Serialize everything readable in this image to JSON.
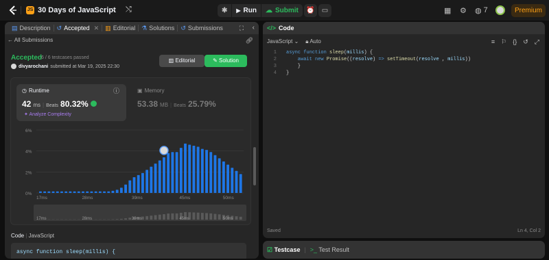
{
  "topbar": {
    "title": "30 Days of JavaScript",
    "run_label": "Run",
    "submit_label": "Submit",
    "streak_count": "7",
    "premium_label": "Premium",
    "js_badge": "JS"
  },
  "left_tabs": [
    {
      "label": "Description",
      "icon": "document-icon"
    },
    {
      "label": "Accepted",
      "icon": "history-icon"
    },
    {
      "label": "Editorial",
      "icon": "book-icon"
    },
    {
      "label": "Solutions",
      "icon": "flask-icon"
    },
    {
      "label": "Submissions",
      "icon": "history-icon"
    }
  ],
  "submission": {
    "back_label": "All Submissions",
    "status": "Accepted",
    "passed": "6 / 6 testcases passed",
    "user": "divyarochani",
    "submitted": "submitted at Mar 19, 2025 22:30",
    "editorial_btn": "Editorial",
    "solution_btn": "Solution"
  },
  "runtime": {
    "label": "Runtime",
    "value": "42",
    "unit": "ms",
    "beats_label": "Beats",
    "beats_value": "80.32%",
    "analyze": "Analyze Complexity"
  },
  "memory": {
    "label": "Memory",
    "value": "53.38",
    "unit": "MB",
    "beats_label": "Beats",
    "beats_value": "25.79%"
  },
  "chart_data": {
    "type": "bar",
    "y_ticks": [
      "6%",
      "4%",
      "2%",
      "0%"
    ],
    "ylim": [
      0,
      6
    ],
    "x_ticks": [
      "17ms",
      "28ms",
      "39ms",
      "45ms",
      "50ms"
    ],
    "mini_ticks": [
      "17ms",
      "28ms",
      "39ms",
      "45ms",
      "50ms"
    ],
    "values": [
      0.15,
      0.15,
      0.15,
      0.15,
      0.15,
      0.15,
      0.15,
      0.15,
      0.15,
      0.15,
      0.15,
      0.15,
      0.15,
      0.15,
      0.15,
      0.15,
      0.15,
      0.2,
      0.3,
      0.5,
      0.8,
      1.2,
      1.5,
      1.7,
      1.9,
      2.2,
      2.5,
      2.8,
      3.1,
      3.4,
      3.8,
      3.9,
      3.9,
      4.3,
      4.7,
      4.6,
      4.5,
      4.4,
      4.2,
      4.1,
      3.9,
      3.6,
      3.3,
      3.0,
      2.7,
      2.4,
      2.1,
      1.8
    ],
    "highlight_index": 29
  },
  "code_section": {
    "label": "Code",
    "lang": "JavaScript",
    "preview": "async function sleep(millis) {"
  },
  "editor": {
    "title": "Code",
    "language": "JavaScript",
    "auto": "Auto",
    "lines": [
      {
        "n": "1",
        "text": "async function sleep(millis) {"
      },
      {
        "n": "2",
        "text": "    await new Promise((resolve) => setTimeout(resolve , millis))"
      },
      {
        "n": "3",
        "text": "    }"
      },
      {
        "n": "4",
        "text": "}"
      }
    ],
    "saved": "Saved",
    "cursor": "Ln 4, Col 2"
  },
  "bottom_tabs": {
    "testcase": "Testcase",
    "result": "Test Result"
  },
  "colors": {
    "accent_green": "#2cbb5d",
    "bar_blue": "#1e76e6",
    "premium": "#ffa116"
  }
}
